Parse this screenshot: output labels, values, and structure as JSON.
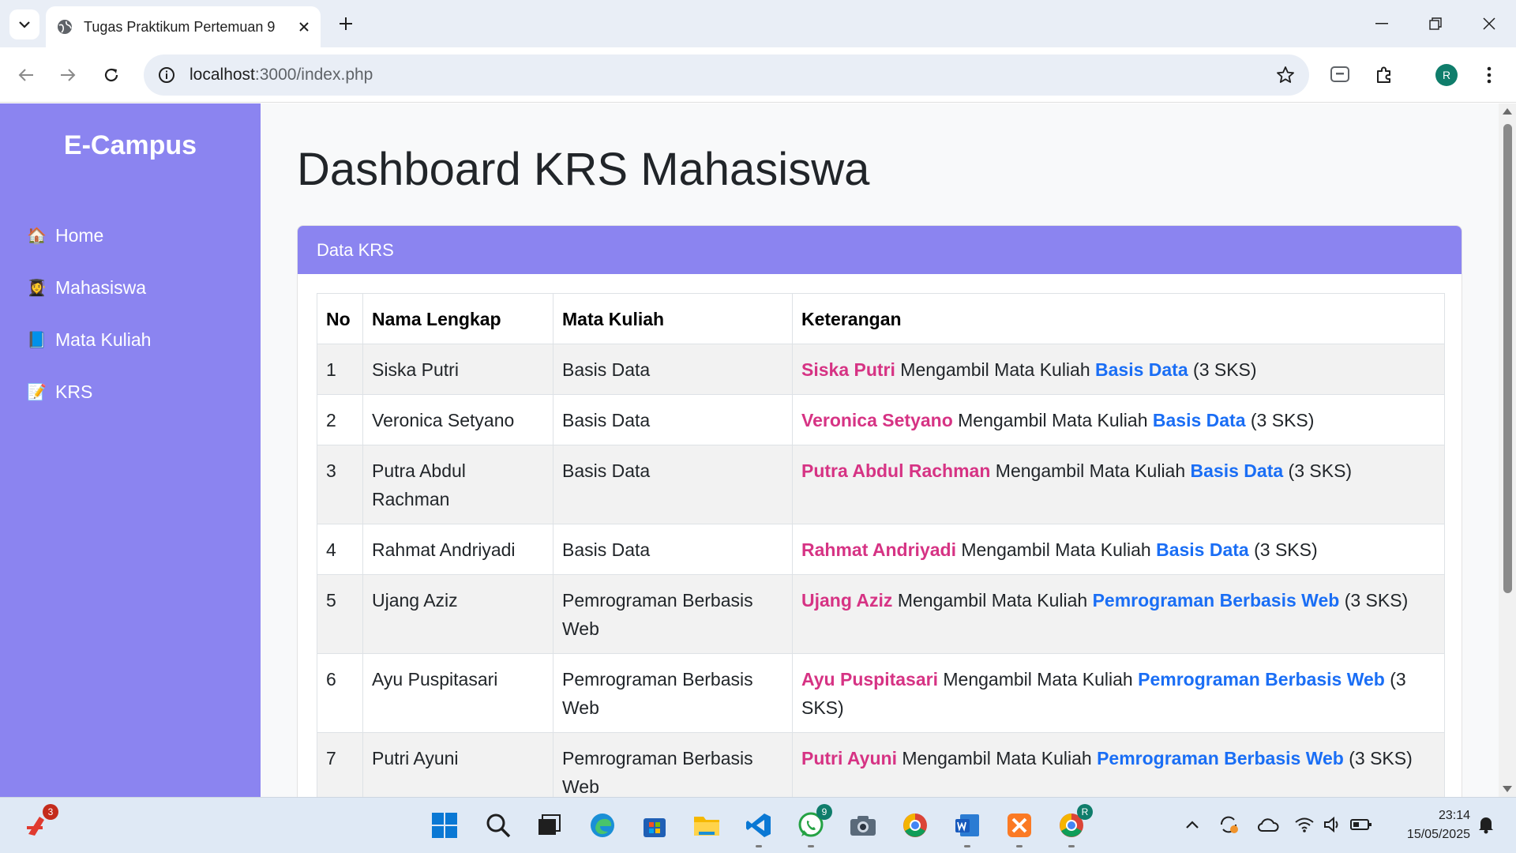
{
  "browser": {
    "tab_title": "Tugas Praktikum Pertemuan 9",
    "url_host": "localhost",
    "url_path": ":3000/index.php",
    "profile_initial": "R"
  },
  "sidebar": {
    "brand": "E-Campus",
    "items": [
      {
        "icon": "🏠",
        "label": "Home"
      },
      {
        "icon": "👩‍🎓",
        "label": "Mahasiswa"
      },
      {
        "icon": "📘",
        "label": "Mata Kuliah"
      },
      {
        "icon": "📝",
        "label": "KRS"
      }
    ]
  },
  "main": {
    "title": "Dashboard KRS Mahasiswa",
    "card_title": "Data KRS",
    "table": {
      "headers": [
        "No",
        "Nama Lengkap",
        "Mata Kuliah",
        "Keterangan"
      ],
      "rows": [
        {
          "no": "1",
          "nama": "Siska Putri",
          "mk": "Basis Data",
          "ket_mid": " Mengambil Mata Kuliah ",
          "ket_sks": " (3 SKS)"
        },
        {
          "no": "2",
          "nama": "Veronica Setyano",
          "mk": "Basis Data",
          "ket_mid": " Mengambil Mata Kuliah ",
          "ket_sks": " (3 SKS)"
        },
        {
          "no": "3",
          "nama": "Putra Abdul Rachman",
          "mk": "Basis Data",
          "ket_mid": " Mengambil Mata Kuliah ",
          "ket_sks": " (3 SKS)"
        },
        {
          "no": "4",
          "nama": "Rahmat Andriyadi",
          "mk": "Basis Data",
          "ket_mid": " Mengambil Mata Kuliah ",
          "ket_sks": " (3 SKS)"
        },
        {
          "no": "5",
          "nama": "Ujang Aziz",
          "mk": "Pemrograman Berbasis Web",
          "ket_mid": " Mengambil Mata Kuliah ",
          "ket_sks": " (3 SKS)"
        },
        {
          "no": "6",
          "nama": "Ayu Puspitasari",
          "mk": "Pemrograman Berbasis Web",
          "ket_mid": " Mengambil Mata Kuliah ",
          "ket_sks": " (3 SKS)"
        },
        {
          "no": "7",
          "nama": "Putri Ayuni",
          "mk": "Pemrograman Berbasis Web",
          "ket_mid": " Mengambil Mata Kuliah ",
          "ket_sks": " (3 SKS)"
        }
      ]
    }
  },
  "taskbar": {
    "notif_badge": "3",
    "whatsapp_badge": "9",
    "chrome_badge": "R",
    "time": "23:14",
    "date": "15/05/2025"
  },
  "colors": {
    "sidebar": "#8b84f0",
    "name_highlight": "#d63384",
    "course_highlight": "#1a6ef5"
  }
}
